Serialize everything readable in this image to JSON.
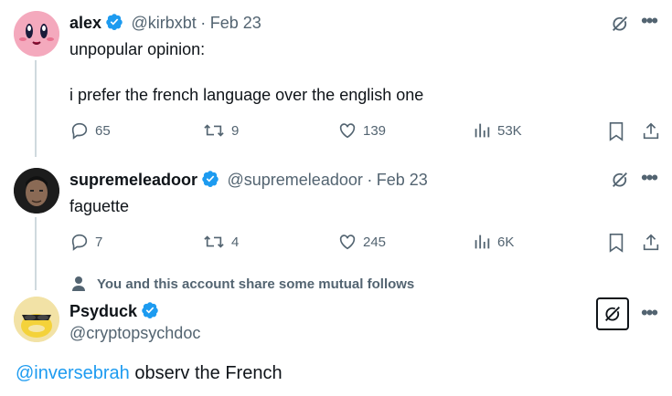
{
  "tweets": [
    {
      "name": "alex",
      "handle": "@kirbxbt",
      "date": "Feb 23",
      "sep": "·",
      "lines": [
        "unpopular opinion:",
        "i prefer the french language over the english one"
      ],
      "replies": "65",
      "reposts": "9",
      "likes": "139",
      "views": "53K"
    },
    {
      "name": "supremeleadoor",
      "handle": "@supremeleadoor",
      "date": "Feb 23",
      "sep": "·",
      "lines": [
        "faguette"
      ],
      "replies": "7",
      "reposts": "4",
      "likes": "245",
      "views": "6K"
    }
  ],
  "mutual_notice": "You and this account share some mutual follows",
  "focus_tweet": {
    "name": "Psyduck",
    "handle": "@cryptopsychdoc",
    "mention": "@inversebrah",
    "text": " observ the French"
  },
  "colors": {
    "verified": "#1d9bf0",
    "muted": "#536471",
    "link": "#1d9bf0",
    "line": "#cfd9de"
  }
}
